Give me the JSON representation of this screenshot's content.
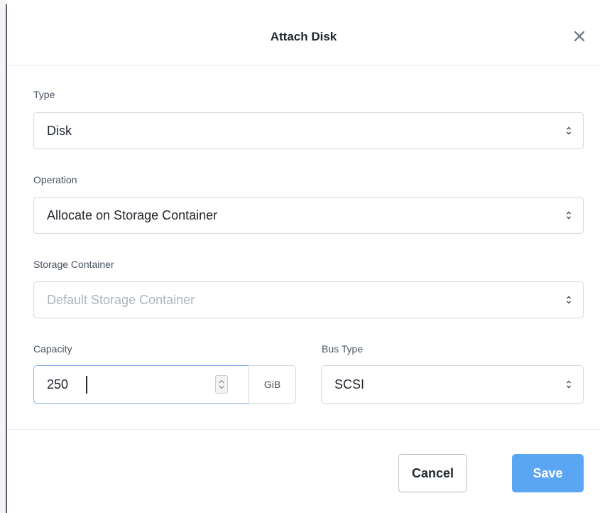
{
  "dialog": {
    "title": "Attach Disk",
    "close_icon": "close-icon"
  },
  "fields": {
    "type": {
      "label": "Type",
      "value": "Disk"
    },
    "operation": {
      "label": "Operation",
      "value": "Allocate on Storage Container"
    },
    "storage_container": {
      "label": "Storage Container",
      "placeholder": "Default Storage Container"
    },
    "capacity": {
      "label": "Capacity",
      "value": "250",
      "unit": "GiB"
    },
    "bus_type": {
      "label": "Bus Type",
      "value": "SCSI"
    }
  },
  "footer": {
    "cancel_label": "Cancel",
    "save_label": "Save"
  },
  "colors": {
    "accent": "#5aa6f2",
    "focus_border": "#7db2ea",
    "placeholder": "#aeb4bd"
  }
}
